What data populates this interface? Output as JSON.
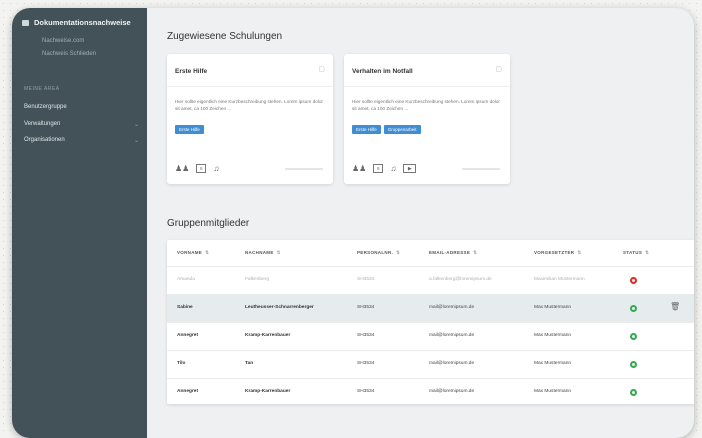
{
  "sidebar": {
    "title": "Dokumentationsnachweise",
    "sub_items": [
      "Nachweise.com",
      "Nachweis Schlieden"
    ],
    "section_label": "MEINE AREA",
    "items": [
      {
        "label": "Benutzergruppe",
        "chevron": false
      },
      {
        "label": "Verwaltungen",
        "chevron": true
      },
      {
        "label": "Organisationen",
        "chevron": true
      }
    ]
  },
  "main": {
    "trainings_title": "Zugewiesene Schulungen",
    "cards": [
      {
        "title": "Erste Hilfe",
        "description": "Hier sollte eigentlich eine Kurzbeschreibung stehen. Lorem ipsum dolor sit amet, ca 100 Zeichen ...",
        "tags": [
          "Erste Hilfe"
        ],
        "icons": [
          "people-icon",
          "document-icon",
          "audio-icon"
        ]
      },
      {
        "title": "Verhalten im Notfall",
        "description": "Hier sollte eigentlich eine Kurzbeschreibung stehen. Lorem ipsum dolor sit amet, ca 100 Zeichen ...",
        "tags": [
          "Erste Hilfe",
          "Gruppenarbeit"
        ],
        "icons": [
          "people-icon",
          "document-icon",
          "audio-icon",
          "video-icon"
        ]
      }
    ],
    "members_title": "Gruppenmitglieder",
    "table": {
      "headers": [
        "VORNAME",
        "NACHNAME",
        "PERSONALNR.",
        "EMAIL-ADRESSE",
        "VORGESETZTER",
        "STATUS"
      ],
      "rows": [
        {
          "vorname": "Amanda",
          "nachname": "Falkenberg",
          "personalnr": "SH3534",
          "email": "a.falkenberg@loremipsum.de",
          "vorgesetzter": "Maximilian Mustermann",
          "status": "error",
          "style": "dim"
        },
        {
          "vorname": "Sabine",
          "nachname": "Leutheusser-Schnarrenberger",
          "personalnr": "SH3534",
          "email": "mail@loremipsum.de",
          "vorgesetzter": "Max Mustermann",
          "status": "ok",
          "style": "highlight"
        },
        {
          "vorname": "Annegret",
          "nachname": "Kramp-Karrenbauer",
          "personalnr": "SH3534",
          "email": "mail@loremipsum.de",
          "vorgesetzter": "Max Mustermann",
          "status": "ok",
          "style": "normal"
        },
        {
          "vorname": "Tilo",
          "nachname": "Tan",
          "personalnr": "SH3534",
          "email": "mail@loremipsum.de",
          "vorgesetzter": "Max Mustermann",
          "status": "ok",
          "style": "normal"
        },
        {
          "vorname": "Annegret",
          "nachname": "Kramp-Karrenbauer",
          "personalnr": "SH3534",
          "email": "mail@loremipsum.de",
          "vorgesetzter": "Max Mustermann",
          "status": "ok",
          "style": "normal"
        }
      ]
    }
  },
  "colors": {
    "sidebar": "#425258",
    "accent": "#3f8ed3",
    "ok": "#34a853",
    "error": "#d93025"
  }
}
